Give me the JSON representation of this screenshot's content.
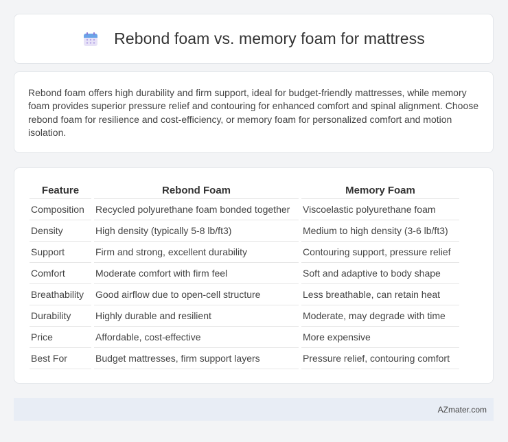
{
  "header": {
    "title": "Rebond foam vs. memory foam for mattress",
    "icon": "calendar-icon"
  },
  "summary": {
    "text": "Rebond foam offers high durability and firm support, ideal for budget-friendly mattresses, while memory foam provides superior pressure relief and contouring for enhanced comfort and spinal alignment. Choose rebond foam for resilience and cost-efficiency, or memory foam for personalized comfort and motion isolation."
  },
  "table": {
    "headers": [
      "Feature",
      "Rebond Foam",
      "Memory Foam"
    ],
    "rows": [
      [
        "Composition",
        "Recycled polyurethane foam bonded together",
        "Viscoelastic polyurethane foam"
      ],
      [
        "Density",
        "High density (typically 5-8 lb/ft3)",
        "Medium to high density (3-6 lb/ft3)"
      ],
      [
        "Support",
        "Firm and strong, excellent durability",
        "Contouring support, pressure relief"
      ],
      [
        "Comfort",
        "Moderate comfort with firm feel",
        "Soft and adaptive to body shape"
      ],
      [
        "Breathability",
        "Good airflow due to open-cell structure",
        "Less breathable, can retain heat"
      ],
      [
        "Durability",
        "Highly durable and resilient",
        "Moderate, may degrade with time"
      ],
      [
        "Price",
        "Affordable, cost-effective",
        "More expensive"
      ],
      [
        "Best For",
        "Budget mattresses, firm support layers",
        "Pressure relief, contouring comfort"
      ]
    ]
  },
  "footer": {
    "text": "AZmater.com"
  }
}
